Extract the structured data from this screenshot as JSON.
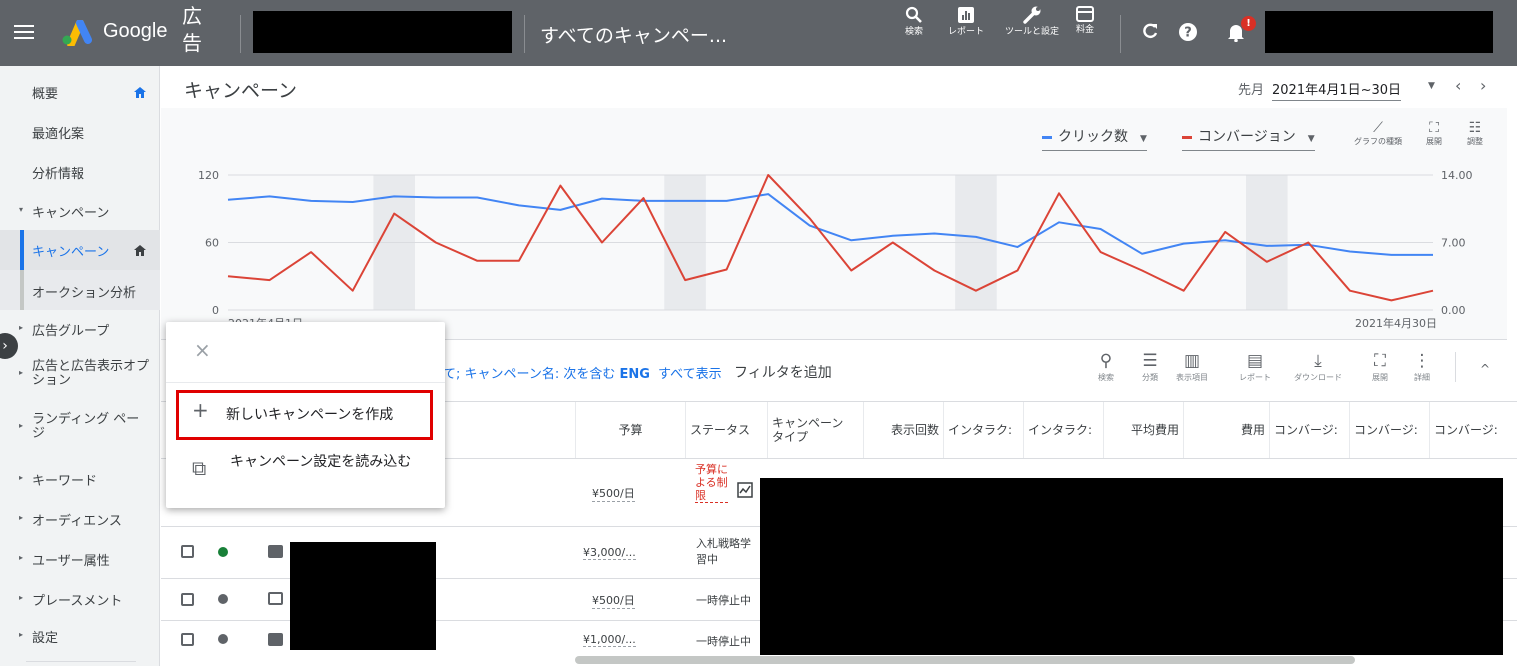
{
  "topbar": {
    "product": "Google",
    "ads_label": "広告",
    "account_title": "すべてのキャンペー...",
    "tools": [
      {
        "icon": "search-icon",
        "label": "検索"
      },
      {
        "icon": "reports-icon",
        "label": "レポート"
      },
      {
        "icon": "wrench-icon",
        "label": "ツールと設定"
      },
      {
        "icon": "billing-icon",
        "label": "料金"
      }
    ],
    "notification_badge": "!"
  },
  "sidebar": {
    "items": [
      {
        "label": "概要",
        "home": true
      },
      {
        "label": "最適化案"
      },
      {
        "label": "分析情報"
      },
      {
        "label": "キャンペーン",
        "caret": "▾"
      },
      {
        "label": "キャンペーン",
        "selected": true,
        "home": true
      },
      {
        "label": "オークション分析"
      },
      {
        "label": "広告グループ",
        "caret": "▸"
      },
      {
        "label": "広告と広告表示オプション",
        "caret": "▸"
      },
      {
        "label": "ランディング ページ",
        "caret": "▸"
      },
      {
        "label": "キーワード",
        "caret": "▸"
      },
      {
        "label": "オーディエンス",
        "caret": "▸"
      },
      {
        "label": "ユーザー属性",
        "caret": "▸"
      },
      {
        "label": "プレースメント",
        "caret": "▸"
      },
      {
        "label": "設定",
        "caret": "▸"
      }
    ]
  },
  "header": {
    "title": "キャンペーン",
    "date_label": "先月",
    "date_range": "2021年4月1日~30日"
  },
  "chart_controls": {
    "metric1": "クリック数",
    "metric2": "コンバージョン",
    "chart_type": "グラフの種類",
    "expand": "展開",
    "adjust": "調整"
  },
  "chart_data": {
    "type": "line",
    "x_start_label": "2021年4月1日",
    "x_end_label": "2021年4月30日",
    "y_left_ticks": [
      "120",
      "60",
      "0"
    ],
    "y_right_ticks": [
      "14.00",
      "7.00",
      "0.00"
    ],
    "ylim_left": [
      0,
      120
    ],
    "ylim_right": [
      0,
      14
    ],
    "series": [
      {
        "name": "クリック数",
        "color": "#4285f4",
        "axis": "left",
        "values": [
          98,
          101,
          97,
          96,
          101,
          100,
          100,
          93,
          89,
          99,
          97,
          97,
          97,
          103,
          75,
          62,
          66,
          68,
          65,
          56,
          78,
          72,
          50,
          59,
          62,
          57,
          58,
          52,
          49,
          49
        ]
      },
      {
        "name": "コンバージョン",
        "color": "#db4437",
        "axis": "right",
        "values": [
          3.5,
          3.1,
          6.0,
          2.0,
          10.0,
          7.0,
          5.1,
          5.1,
          12.9,
          7.0,
          11.6,
          3.1,
          4.2,
          14.0,
          9.5,
          4.1,
          7.0,
          4.1,
          2.0,
          4.1,
          12.1,
          6.0,
          4.1,
          2.0,
          8.1,
          5.0,
          7.0,
          2.0,
          1.0,
          2.0
        ]
      }
    ],
    "weekend_bands_days": [
      4,
      11,
      18,
      25
    ]
  },
  "filter": {
    "text": "て; キャンペーン名: 次を含む",
    "text_bold": "ENG",
    "show_all": "すべて表示",
    "add_filter": "フィルタを追加"
  },
  "table_tools": [
    {
      "label": "検索",
      "glyph": "⚲"
    },
    {
      "label": "分類",
      "glyph": "☰"
    },
    {
      "label": "表示項目",
      "glyph": "▥"
    },
    {
      "label": "レポート",
      "glyph": "▤"
    },
    {
      "label": "ダウンロード",
      "glyph": "⤓"
    },
    {
      "label": "展開",
      "glyph": "⛶"
    },
    {
      "label": "詳細",
      "glyph": "⋮"
    }
  ],
  "table": {
    "columns": [
      "予算",
      "ステータス",
      "キャンペーン\nタイプ",
      "表示回数",
      "インタラク:",
      "インタラク:",
      "平均費用",
      "費用",
      "コンバージ:",
      "コンバージ:",
      "コンバージ:"
    ],
    "rows": [
      {
        "budget": "¥500/日",
        "status": "予算に\nよる制\n限",
        "status_limited": true
      },
      {
        "budget": "¥3,000/...",
        "status": "入札戦略学\n習中",
        "active": true
      },
      {
        "budget": "¥500/日",
        "status": "一時停止中"
      },
      {
        "budget": "¥1,000/...",
        "status": "一時停止中"
      }
    ]
  },
  "popup": {
    "close": "×",
    "items": [
      {
        "icon": "plus-icon",
        "glyph": "+",
        "label": "新しいキャンペーンを作成"
      },
      {
        "icon": "copy-icon",
        "glyph": "⧉",
        "label": "キャンペーン設定を読み込む"
      }
    ]
  },
  "colors": {
    "topbar": "#5f6368",
    "accent": "#1a73e8",
    "clicks": "#4285f4",
    "conversions": "#db4437",
    "highlight": "#e00000"
  }
}
